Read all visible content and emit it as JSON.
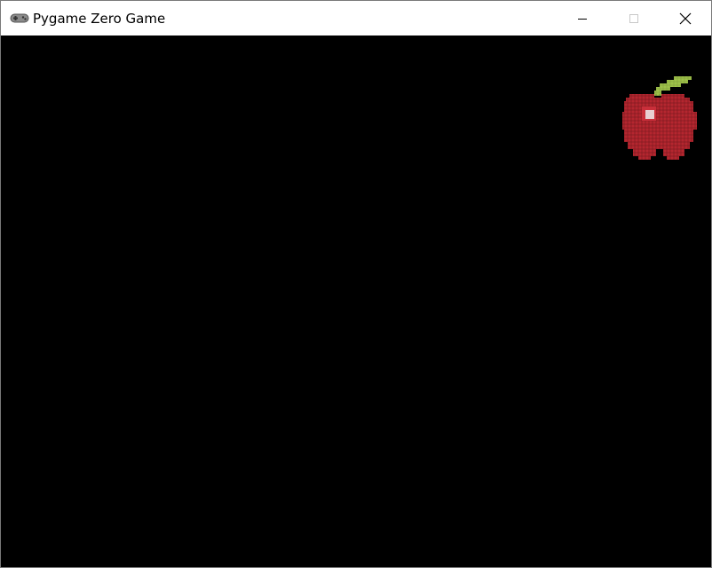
{
  "window": {
    "title": "Pygame Zero Game"
  },
  "icons": {
    "app": "gamepad-icon",
    "minimize": "minimize-icon",
    "maximize": "maximize-icon",
    "close": "close-icon"
  },
  "game": {
    "background_color": "#000000",
    "sprites": [
      {
        "name": "apple",
        "colors": {
          "body": "#b5262f",
          "leaf": "#9fc24a",
          "highlight": "#e8d0d2"
        }
      }
    ]
  }
}
